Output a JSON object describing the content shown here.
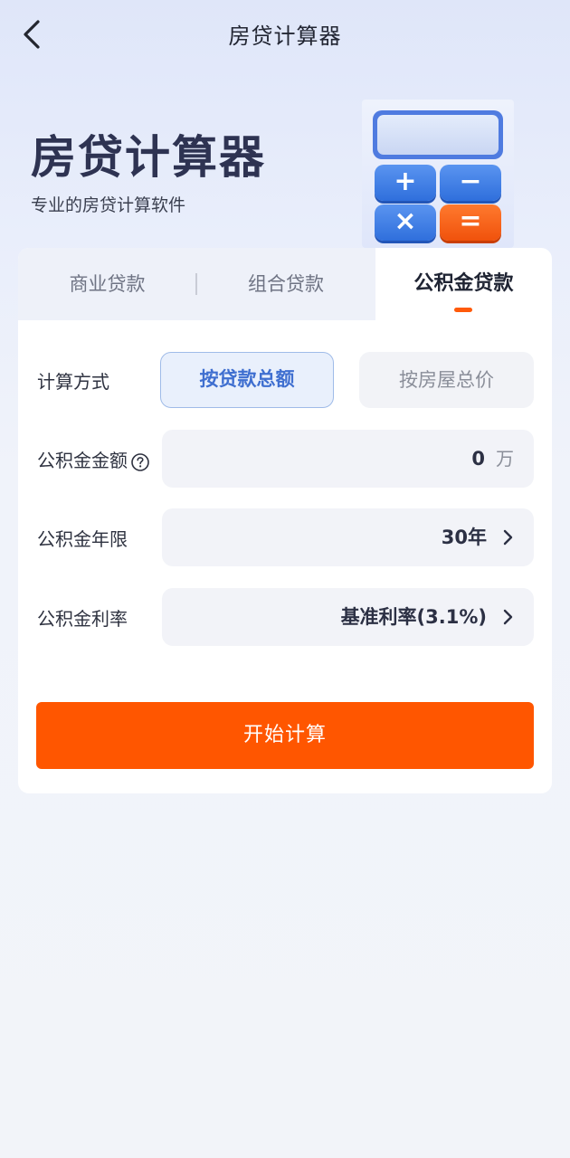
{
  "header": {
    "title": "房贷计算器"
  },
  "hero": {
    "title": "房贷计算器",
    "subtitle": "专业的房贷计算软件",
    "calculator_keys": [
      "+",
      "−",
      "×",
      "="
    ]
  },
  "tabs": [
    {
      "label": "商业贷款",
      "active": false
    },
    {
      "label": "组合贷款",
      "active": false
    },
    {
      "label": "公积金贷款",
      "active": true
    }
  ],
  "form": {
    "method": {
      "label": "计算方式",
      "options": [
        "按贷款总额",
        "按房屋总价"
      ],
      "selected": "按贷款总额"
    },
    "amount": {
      "label": "公积金金额",
      "value": "0",
      "unit": "万"
    },
    "years": {
      "label": "公积金年限",
      "value": "30年"
    },
    "rate": {
      "label": "公积金利率",
      "value": "基准利率(3.1%)"
    }
  },
  "submit_label": "开始计算",
  "colors": {
    "accent": "#ff5600",
    "active_blue": "#3f6fd0",
    "title_dark": "#2e3352"
  }
}
